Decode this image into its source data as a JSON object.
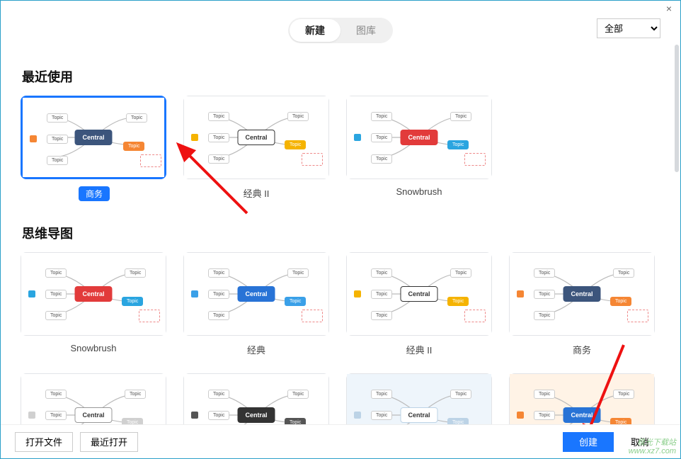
{
  "window": {
    "close_glyph": "×"
  },
  "tabs": {
    "new": "新建",
    "gallery": "图库"
  },
  "filter": {
    "selected": "全部",
    "options": [
      "全部"
    ]
  },
  "sections": {
    "recent": {
      "title": "最近使用",
      "items": [
        {
          "label": "商务",
          "selected": true,
          "central_bg": "#3c557c",
          "accent": "#f58634"
        },
        {
          "label": "经典 II",
          "selected": false,
          "central_bg": "#ffffff",
          "accent": "#f5b301",
          "central_fg": "#333",
          "central_border": "#333"
        },
        {
          "label": "Snowbrush",
          "selected": false,
          "central_bg": "#e23b3b",
          "accent": "#2aa5e0"
        }
      ]
    },
    "mindmap": {
      "title": "思维导图",
      "items": [
        {
          "label": "Snowbrush",
          "central_bg": "#e23b3b",
          "accent": "#2aa5e0"
        },
        {
          "label": "经典",
          "central_bg": "#2873d6",
          "accent": "#3aa0e8"
        },
        {
          "label": "经典 II",
          "central_bg": "#ffffff",
          "accent": "#f5b301",
          "central_fg": "#333",
          "central_border": "#333"
        },
        {
          "label": "商务",
          "central_bg": "#3c557c",
          "accent": "#f58634"
        },
        {
          "label": "",
          "central_bg": "#ffffff",
          "accent": "#d0d0d0",
          "central_fg": "#333",
          "central_border": "#999",
          "bg": "#ffffff"
        },
        {
          "label": "",
          "central_bg": "#333333",
          "accent": "#555555",
          "bg": "#ffffff"
        },
        {
          "label": "",
          "central_bg": "#ffffff",
          "accent": "#bcd3e6",
          "central_fg": "#333",
          "central_border": "#bcd3e6",
          "bg": "#eef5fb"
        },
        {
          "label": "",
          "central_bg": "#2873d6",
          "accent": "#f58634",
          "bg": "#fff3e6"
        }
      ]
    }
  },
  "footer": {
    "open_file": "打开文件",
    "recent_open": "最近打开",
    "create": "创建",
    "cancel": "取消"
  },
  "mindmap_glyph": {
    "central": "Central",
    "topic": "Topic"
  },
  "watermark": {
    "line1": "极光下载站",
    "line2": "www.xz7.com"
  }
}
